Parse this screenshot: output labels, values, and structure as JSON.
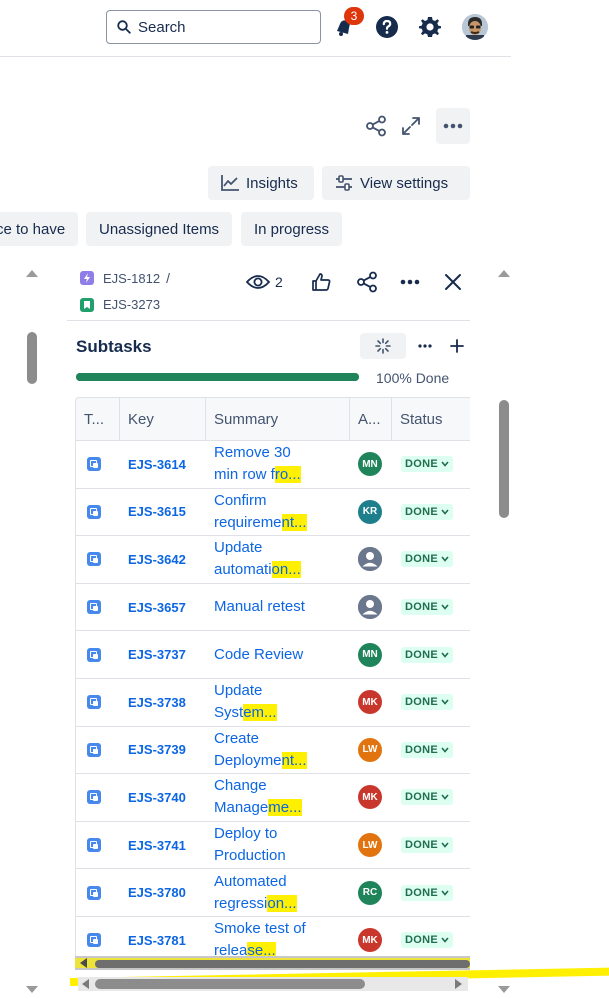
{
  "nav": {
    "search_label": "Search",
    "notification_count": "3"
  },
  "toolbar": {
    "insights_label": "Insights",
    "view_settings_label": "View settings"
  },
  "filters": [
    "ce to have",
    "Unassigned Items",
    "In progress"
  ],
  "issue": {
    "parent_key": "EJS-1812",
    "separator": "/",
    "key": "EJS-3273",
    "watch_count": "2"
  },
  "subtasks": {
    "title": "Subtasks",
    "progress_percent": 100,
    "progress_label": "100% Done",
    "columns": [
      "T...",
      "Key",
      "Summary",
      "A...",
      "Status"
    ],
    "rows": [
      {
        "key": "EJS-3614",
        "summary": [
          "Remove 30",
          "min row fro..."
        ],
        "assignee": "MN",
        "avatar_color": "#1f845a",
        "status": "DONE"
      },
      {
        "key": "EJS-3615",
        "summary": [
          "Confirm",
          "requirement..."
        ],
        "assignee": "KR",
        "avatar_color": "#1d7f8c",
        "status": "DONE"
      },
      {
        "key": "EJS-3642",
        "summary": [
          "Update",
          "automation..."
        ],
        "assignee": "",
        "avatar_color": "#6b778c",
        "status": "DONE"
      },
      {
        "key": "EJS-3657",
        "summary": [
          "Manual retest"
        ],
        "assignee": "",
        "avatar_color": "#6b778c",
        "status": "DONE"
      },
      {
        "key": "EJS-3737",
        "summary": [
          "Code Review"
        ],
        "assignee": "MN",
        "avatar_color": "#1f845a",
        "status": "DONE"
      },
      {
        "key": "EJS-3738",
        "summary": [
          "Update",
          "System..."
        ],
        "assignee": "MK",
        "avatar_color": "#c9372c",
        "status": "DONE"
      },
      {
        "key": "EJS-3739",
        "summary": [
          "Create",
          "Deployment..."
        ],
        "assignee": "LW",
        "avatar_color": "#e2740f",
        "status": "DONE"
      },
      {
        "key": "EJS-3740",
        "summary": [
          "Change",
          "Manageme..."
        ],
        "assignee": "MK",
        "avatar_color": "#c9372c",
        "status": "DONE"
      },
      {
        "key": "EJS-3741",
        "summary": [
          "Deploy to",
          "Production"
        ],
        "assignee": "LW",
        "avatar_color": "#e2740f",
        "status": "DONE"
      },
      {
        "key": "EJS-3780",
        "summary": [
          "Automated",
          "regression..."
        ],
        "assignee": "RC",
        "avatar_color": "#1f845a",
        "status": "DONE"
      },
      {
        "key": "EJS-3781",
        "summary": [
          "Smoke test of",
          "release..."
        ],
        "assignee": "MK",
        "avatar_color": "#c9372c",
        "status": "DONE"
      }
    ]
  }
}
